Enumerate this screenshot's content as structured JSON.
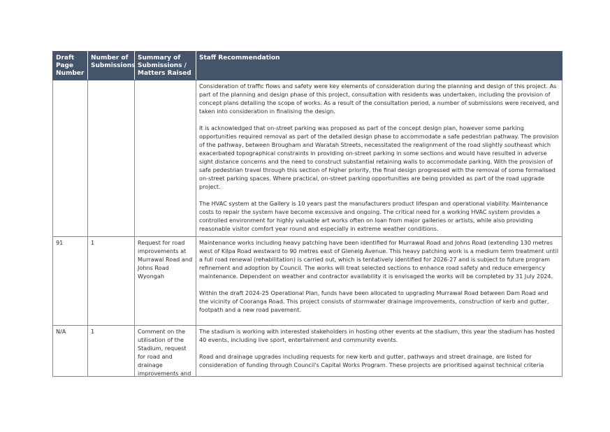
{
  "table": {
    "headers": [
      "Draft Page Number",
      "Number of Submissions",
      "Summary of Submissions / Matters Raised",
      "Staff Recommendation"
    ],
    "rows": [
      {
        "page": "",
        "count": "",
        "summary": "",
        "paragraphs": [
          "Consideration of traffic flows and safety were key elements of consideration during the planning and design of this project. As part of the planning and design phase of this project, consultation with residents was undertaken, including the provision of concept plans detailing the scope of works. As a result of the consultation period, a number of submissions were received, and taken into consideration in finalising the design.",
          "It is acknowledged that on-street parking was proposed as part of the concept design plan, however some parking opportunities required removal as part of the detailed design phase to accommodate a safe pedestrian pathway. The provision of the pathway, between Brougham and Waratah Streets, necessitated the realignment of the road slightly southeast which exacerbated topographical constraints in providing on-street parking in some sections and would have resulted in adverse sight distance concerns and the need to construct substantial retaining walls to accommodate parking. With the provision of safe pedestrian travel through this section of higher priority, the final design progressed with the removal of some formalised on-street parking spaces. Where practical, on-street parking opportunities are being provided as part of the road upgrade project.",
          "The HVAC system at the Gallery is 10 years past the manufacturers product lifespan and operational viability. Maintenance costs to repair the system have become excessive and ongoing. The critical need for a working HVAC system provides a controlled environment for highly valuable art works often on loan from major galleries or artists, while also providing reasonable visitor comfort year round and especially in extreme weather conditions."
        ]
      },
      {
        "page": "91",
        "count": "1",
        "summary": "Request for road improvements at Murrawal Road and Johns Road Wyongah",
        "paragraphs": [
          "Maintenance works including heavy patching have been identified for Murrawal Road and Johns Road (extending 130 metres west of Kilpa Road westward to 90 metres east of Glenelg Avenue. This heavy patching work is a medium term treatment until a full road renewal (rehabilitation) is carried out, which is tentatively identified for 2026-27 and is subject to future program refinement and adoption by Council. The works will treat selected sections to enhance road safety and reduce emergency maintenance. Dependent on weather and contractor availability it is envisaged the works will be completed by 31 July 2024.",
          "Within the draft 2024-25 Operational Plan, funds have been allocated to upgrading Murrawal Road between Dam Road and the vicinity of Cooranga Road. This project consists of stormwater drainage improvements, construction of kerb and gutter, footpath and a new road pavement."
        ]
      },
      {
        "page": "N/A",
        "count": "1",
        "summary": "Comment on the utilisation of the Stadium, request for road and drainage improvements and",
        "paragraphs": [
          "The stadium is working with interested stakeholders in hosting other events at the stadium, this year the stadium has hosted 40 events, including live sport, entertainment and community events.",
          "Road and drainage upgrades including requests for new kerb and gutter, pathways and street drainage, are listed for consideration of funding through Council's Capital Works Program. These projects are prioritised against technical criteria"
        ]
      }
    ]
  }
}
